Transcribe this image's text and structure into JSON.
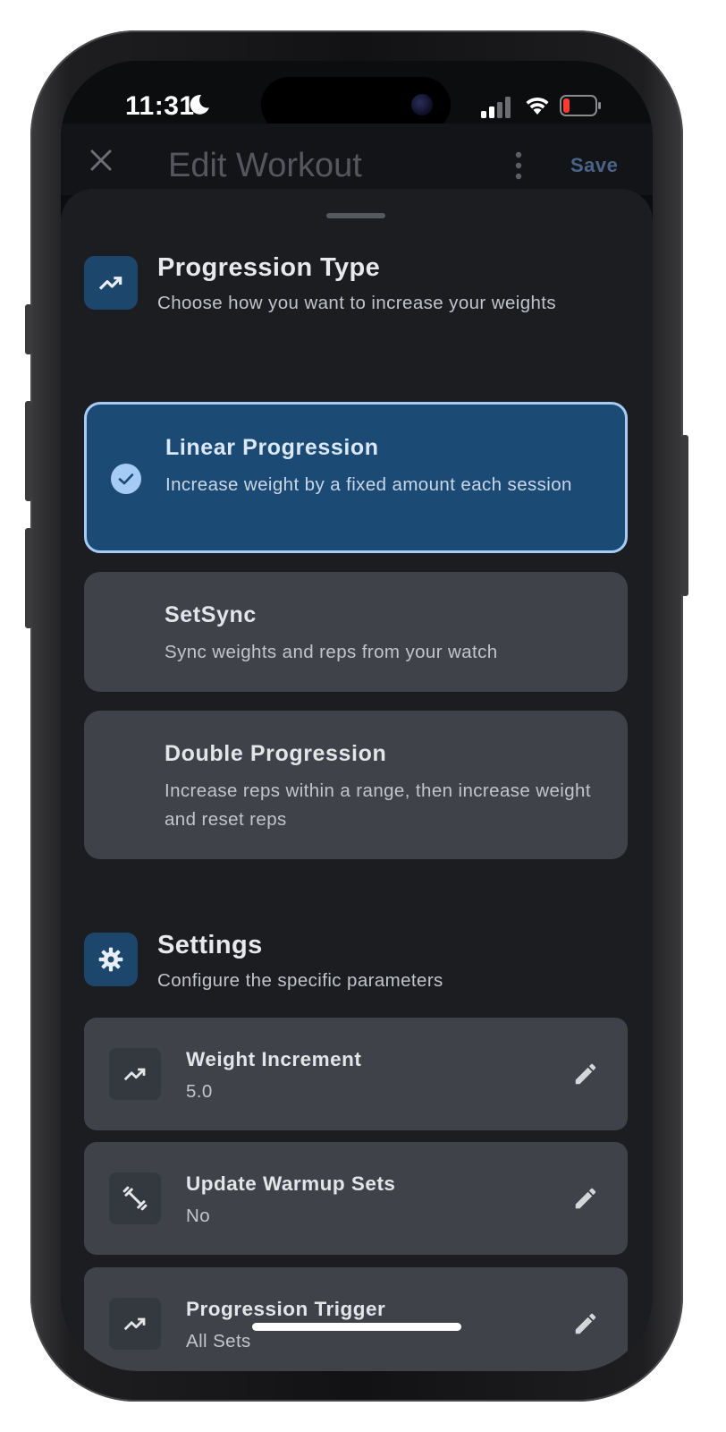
{
  "status_bar": {
    "time": "11:31"
  },
  "header": {
    "title": "Edit Workout",
    "save_label": "Save"
  },
  "progression_section": {
    "title": "Progression Type",
    "subtitle": "Choose how you want to increase your weights",
    "options": [
      {
        "title": "Linear Progression",
        "description": "Increase weight by a fixed amount each session",
        "selected": true
      },
      {
        "title": "SetSync",
        "description": "Sync weights and reps from your watch",
        "selected": false
      },
      {
        "title": "Double Progression",
        "description": "Increase reps within a range, then increase weight and reset reps",
        "selected": false
      }
    ]
  },
  "settings_section": {
    "title": "Settings",
    "subtitle": "Configure the specific parameters",
    "items": [
      {
        "label": "Weight Increment",
        "value": "5.0",
        "icon": "trending-up-icon"
      },
      {
        "label": "Update Warmup Sets",
        "value": "No",
        "icon": "dumbbell-icon"
      },
      {
        "label": "Progression Trigger",
        "value": "All Sets",
        "icon": "trending-up-icon"
      }
    ]
  },
  "colors": {
    "accent": "#1b4a74",
    "accent_border": "#a6cbf5",
    "sheet_bg": "#1b1d21",
    "card_bg": "#3f4248"
  }
}
